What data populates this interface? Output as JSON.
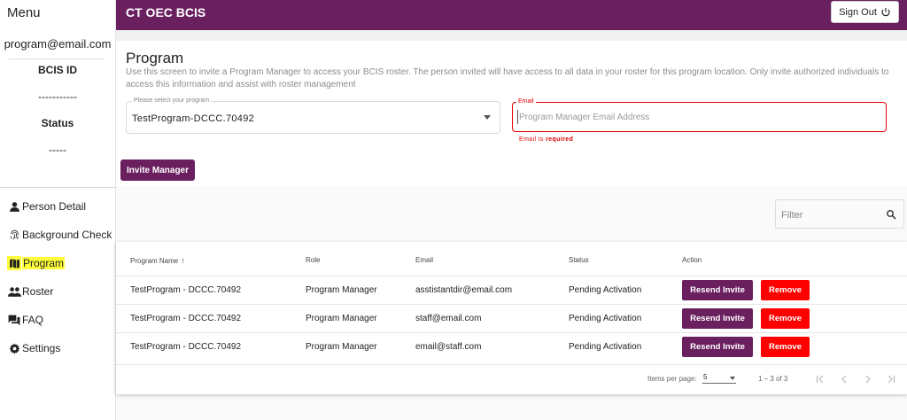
{
  "sidebar": {
    "menu_title": "Menu",
    "user_email": "program@email.com",
    "bcis_label": "BCIS ID",
    "bcis_value": "-----------",
    "status_label": "Status",
    "status_value": "-----",
    "items": [
      {
        "label": "Person Detail",
        "icon": "person-icon"
      },
      {
        "label": "Background Check",
        "icon": "fingerprint-icon"
      },
      {
        "label": "Program",
        "icon": "map-icon",
        "active": true
      },
      {
        "label": "Roster",
        "icon": "people-icon"
      },
      {
        "label": "FAQ",
        "icon": "forum-icon"
      },
      {
        "label": "Settings",
        "icon": "gear-icon"
      }
    ]
  },
  "header": {
    "app_title": "CT OEC BCIS",
    "sign_out_label": "Sign Out",
    "brand_color": "#6a1f5f"
  },
  "program": {
    "title": "Program",
    "description": "Use this screen to invite a Program Manager to access your BCIS roster. The person invited will have access to all data in your roster for this program location. Only invite authorized individuals to access this information and assist with roster management",
    "select_label": "Please select your program",
    "select_value": "TestProgram-DCCC.70492",
    "email_label": "Email",
    "email_placeholder": "Program Manager Email Address",
    "email_value": "",
    "email_error_prefix": "Email is ",
    "email_error_strong": "required",
    "invite_label": "Invite Manager"
  },
  "filter": {
    "placeholder": "Filter"
  },
  "table": {
    "headers": {
      "program_name": "Program Name",
      "role": "Role",
      "email": "Email",
      "status": "Status",
      "action": "Action"
    },
    "rows": [
      {
        "program_name": "TestProgram - DCCC.70492",
        "role": "Program Manager",
        "email": "asstistantdir@email.com",
        "status": "Pending Activation"
      },
      {
        "program_name": "TestProgram - DCCC.70492",
        "role": "Program Manager",
        "email": "staff@email.com",
        "status": "Pending Activation"
      },
      {
        "program_name": "TestProgram - DCCC.70492",
        "role": "Program Manager",
        "email": "email@staff.com",
        "status": "Pending Activation"
      }
    ],
    "resend_label": "Resend Invite",
    "remove_label": "Remove",
    "remove_color": "#ff0000"
  },
  "paginator": {
    "items_per_page_label": "Items per page:",
    "items_per_page_value": "5",
    "range_label": "1 – 3 of 3"
  }
}
